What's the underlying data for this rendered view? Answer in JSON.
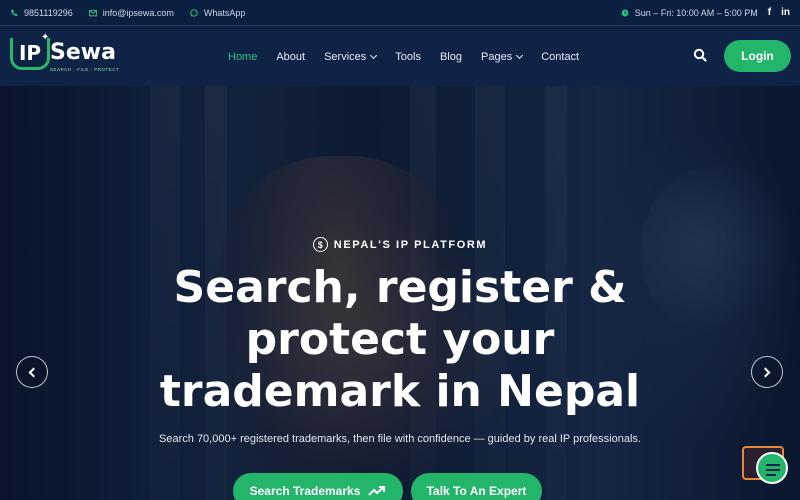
{
  "topbar": {
    "phone": "9851119296",
    "email": "info@ipsewa.com",
    "whatsapp": "WhatsApp",
    "hours": "Sun – Fri: 10:00 AM – 5:00 PM",
    "social": [
      "f",
      "in"
    ]
  },
  "header": {
    "logo": {
      "mark": "IP",
      "name": "Sewa",
      "tagline": "SEARCH · FILE · PROTECT"
    },
    "nav": [
      {
        "label": "Home",
        "active": true,
        "dropdown": false
      },
      {
        "label": "About",
        "active": false,
        "dropdown": false
      },
      {
        "label": "Services",
        "active": false,
        "dropdown": true
      },
      {
        "label": "Tools",
        "active": false,
        "dropdown": false
      },
      {
        "label": "Blog",
        "active": false,
        "dropdown": false
      },
      {
        "label": "Pages",
        "active": false,
        "dropdown": true
      },
      {
        "label": "Contact",
        "active": false,
        "dropdown": false
      }
    ],
    "login_label": "Login"
  },
  "hero": {
    "eyebrow_icon": "$",
    "eyebrow": "NEPAL'S IP PLATFORM",
    "headline_line1": "Search, register &",
    "headline_line2": "protect your",
    "headline_line3": "trademark in Nepal",
    "subtitle": "Search 70,000+ registered trademarks, then file with confidence — guided by real IP professionals.",
    "primary_button": "Search Trademarks",
    "secondary_button": "Talk To An Expert"
  },
  "icons": {
    "phone": "phone-icon",
    "email": "mail-icon",
    "whatsapp": "whatsapp-icon",
    "clock": "clock-icon",
    "search": "search-icon",
    "trend": "trending-up-icon",
    "chat": "chat-widget-icon"
  },
  "colors": {
    "accent": "#23b56a",
    "topbar": "#0b2040",
    "header": "#0f2347",
    "active_nav": "#2bc27a"
  }
}
